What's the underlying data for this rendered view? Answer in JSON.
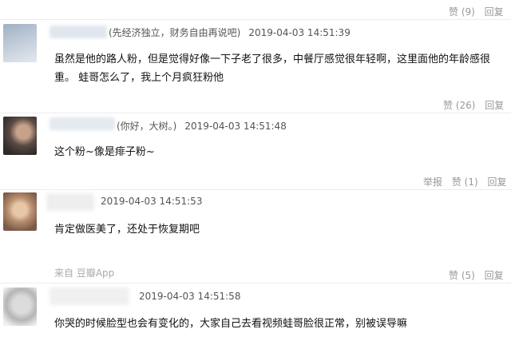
{
  "comments": [
    {
      "partial_text": "(先经济独立，财务自由再说吧)",
      "timestamp": "2019-04-03 14:51:39",
      "content": "虽然是他的路人粉，但是觉得好像一下子老了很多，中餐厅感觉很年轻啊，这里面他的年龄感很重。 蛙哥怎么了，我上个月疯狂粉他",
      "like_label": "赞 (26)",
      "reply_label": "回复"
    },
    {
      "partial_text": "(你好，大树。)",
      "timestamp": "2019-04-03 14:51:48",
      "content": "这个粉~像是痱子粉~",
      "report_label": "举报",
      "like_label": "赞 (1)",
      "reply_label": "回复"
    },
    {
      "partial_text": "",
      "timestamp": "2019-04-03 14:51:53",
      "content": "肯定做医美了，还处于恢复期吧",
      "source_label": "来自 豆瓣App",
      "like_label": "赞 (5)",
      "reply_label": "回复"
    },
    {
      "partial_text": "",
      "timestamp": "2019-04-03 14:51:58",
      "content": "你哭的时候脸型也会有变化的，大家自己去看视频蛙哥脸很正常，别被误导嘛"
    }
  ],
  "top_actions": {
    "like_label": "赞 (9)",
    "reply_label": "回复"
  },
  "colors": {
    "text": "#111111",
    "meta": "#555555",
    "action": "#999999",
    "separator": "#ececec"
  }
}
